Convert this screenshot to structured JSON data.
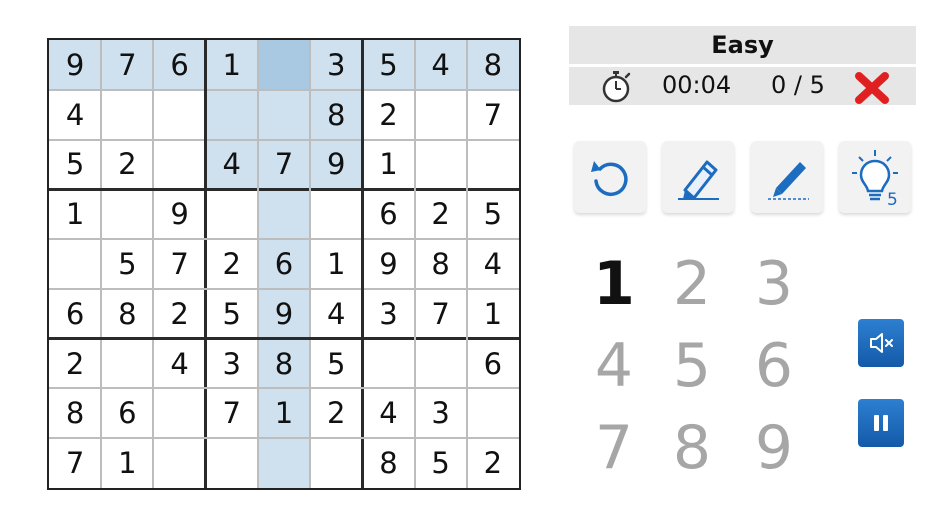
{
  "game": {
    "difficulty": "Easy",
    "timer": "00:04",
    "mistakes": "0 / 5",
    "hint_count": "5",
    "highlight_color": "#cfe1ef",
    "selected_color": "#a9c9e3"
  },
  "board": {
    "rows": [
      [
        "9",
        "7",
        "6",
        "1",
        "",
        "3",
        "5",
        "4",
        "8"
      ],
      [
        "4",
        "",
        "",
        "",
        "",
        "8",
        "2",
        "",
        "7"
      ],
      [
        "5",
        "2",
        "",
        "4",
        "7",
        "9",
        "1",
        "",
        ""
      ],
      [
        "1",
        "",
        "9",
        "",
        "",
        "",
        "6",
        "2",
        "5"
      ],
      [
        "",
        "5",
        "7",
        "2",
        "6",
        "1",
        "9",
        "8",
        "4"
      ],
      [
        "6",
        "8",
        "2",
        "5",
        "9",
        "4",
        "3",
        "7",
        "1"
      ],
      [
        "2",
        "",
        "4",
        "3",
        "8",
        "5",
        "",
        "",
        "6"
      ],
      [
        "8",
        "6",
        "",
        "7",
        "1",
        "2",
        "4",
        "3",
        ""
      ],
      [
        "7",
        "1",
        "",
        "",
        "",
        "",
        "8",
        "5",
        "2"
      ]
    ],
    "selected": {
      "row": 0,
      "col": 4
    }
  },
  "toolbar": [
    {
      "name": "undo-button",
      "icon": "undo-icon"
    },
    {
      "name": "erase-button",
      "icon": "eraser-pencil-icon"
    },
    {
      "name": "notes-button",
      "icon": "pencil-icon"
    },
    {
      "name": "hint-button",
      "icon": "lightbulb-icon"
    }
  ],
  "numpad": {
    "keys": [
      "1",
      "2",
      "3",
      "4",
      "5",
      "6",
      "7",
      "8",
      "9"
    ],
    "active": "1"
  },
  "side_buttons": [
    "mute-icon",
    "pause-icon"
  ],
  "colors": {
    "accent": "#1c6cc0",
    "mistake": "#e02020",
    "panel": "#e6e6e6"
  }
}
